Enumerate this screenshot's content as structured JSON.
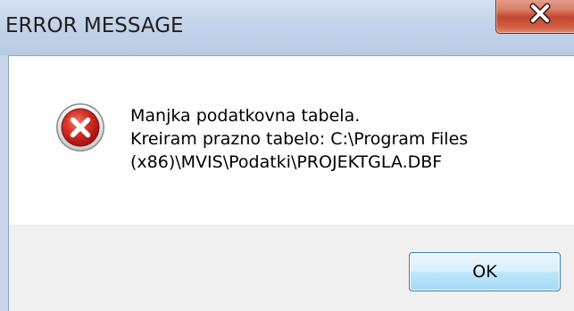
{
  "window": {
    "title": "ERROR MESSAGE",
    "close_icon": "close-icon"
  },
  "message": {
    "icon": "error-icon",
    "line1": "Manjka podatkovna tabela.",
    "line2": "Kreiram prazno tabelo: C:\\Program Files",
    "line3": "(x86)\\MVIS\\Podatki\\PROJEKTGLA.DBF"
  },
  "buttons": {
    "ok_label": "OK"
  },
  "colors": {
    "titlebar": "#c3d3e8",
    "close_button": "#c3462e",
    "error_icon": "#c8201b",
    "ok_button_border": "#3c7fb1"
  }
}
